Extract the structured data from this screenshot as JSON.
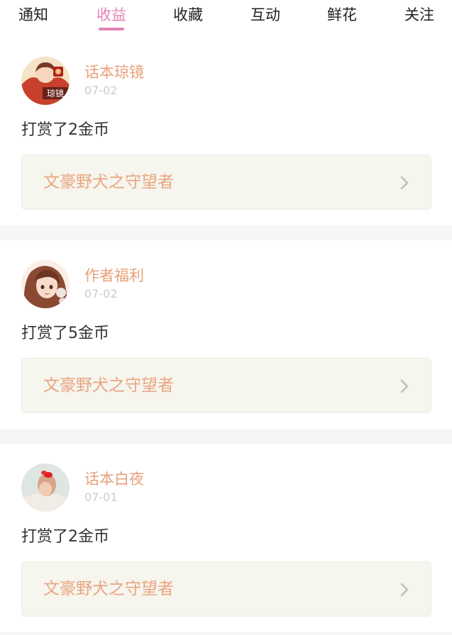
{
  "tabs": [
    {
      "label": "通知",
      "active": false
    },
    {
      "label": "收益",
      "active": true
    },
    {
      "label": "收藏",
      "active": false
    },
    {
      "label": "互动",
      "active": false
    },
    {
      "label": "鲜花",
      "active": false
    },
    {
      "label": "关注",
      "active": false
    }
  ],
  "theme": {
    "accent": "#e383b8",
    "username_color": "#e8a07a",
    "work_title_color": "#e9a57f"
  },
  "feed": [
    {
      "username": "话本琼镜",
      "date": "07-02",
      "reward": "打赏了2金币",
      "work_title": "文豪野犬之守望者",
      "avatar_icon": "illustrated-avatar-icon",
      "avatar_badge": "琼镜"
    },
    {
      "username": "作者福利",
      "date": "07-02",
      "reward": "打赏了5金币",
      "work_title": "文豪野犬之守望者",
      "avatar_icon": "anime-girl-avatar-icon"
    },
    {
      "username": "话本白夜",
      "date": "07-01",
      "reward": "打赏了2金币",
      "work_title": "文豪野犬之守望者",
      "avatar_icon": "photo-avatar-icon"
    }
  ]
}
